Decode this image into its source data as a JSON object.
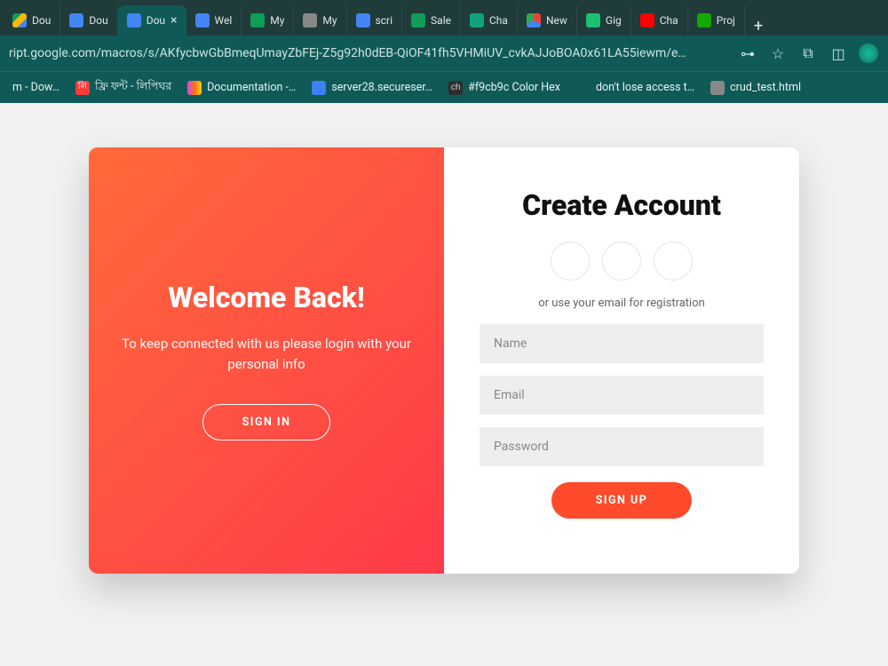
{
  "browser": {
    "tabs": [
      {
        "title": "Dou"
      },
      {
        "title": "Dou"
      },
      {
        "title": "Dou",
        "active": true
      },
      {
        "title": "Wel"
      },
      {
        "title": "My"
      },
      {
        "title": "My"
      },
      {
        "title": "scri"
      },
      {
        "title": "Sale"
      },
      {
        "title": "Cha"
      },
      {
        "title": "New"
      },
      {
        "title": "Gig"
      },
      {
        "title": "Cha"
      },
      {
        "title": "Proj"
      }
    ],
    "url": "ript.google.com/macros/s/AKfycbwGbBmeqUmayZbFEj-Z5g92h0dEB-QiOF41fh5VHMiUV_cvkAJJoBOA0x61LA55iewm/e…",
    "bookmarks": [
      {
        "label": "m - Dow…"
      },
      {
        "label": "ফ্রি ফন্ট - লিপিঘর"
      },
      {
        "label": "Documentation -…"
      },
      {
        "label": "server28.secureser…"
      },
      {
        "label": "#f9cb9c Color Hex"
      },
      {
        "label": "don't lose access t…"
      },
      {
        "label": "crud_test.html"
      }
    ]
  },
  "left": {
    "heading": "Welcome Back!",
    "subtext": "To keep connected with us please login with your personal info",
    "button": "SIGN IN"
  },
  "right": {
    "heading": "Create Account",
    "subtext": "or use your email for registration",
    "name_placeholder": "Name",
    "email_placeholder": "Email",
    "password_placeholder": "Password",
    "button": "SIGN UP"
  }
}
